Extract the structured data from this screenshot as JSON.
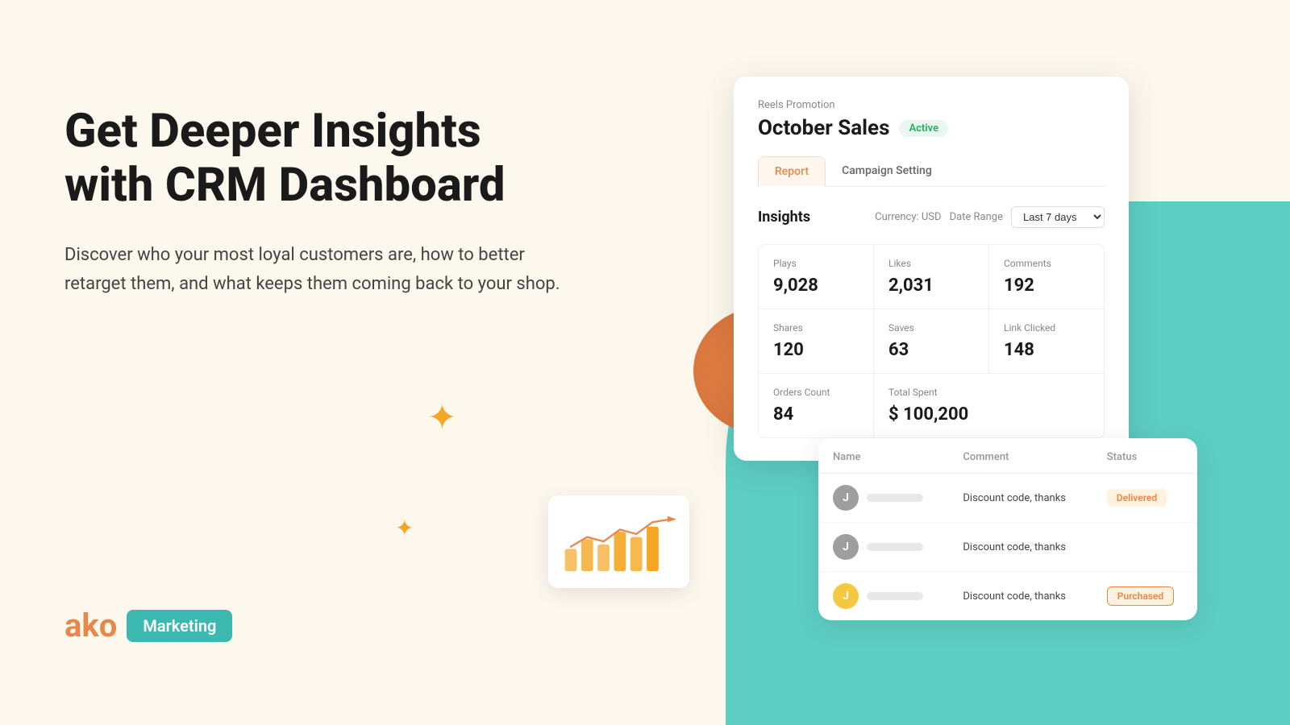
{
  "page": {
    "background_color": "#fdf8ee"
  },
  "hero": {
    "heading": "Get Deeper Insights with CRM Dashboard",
    "subtext": "Discover who your most loyal customers are, how to better retarget them, and what keeps them coming back to your shop."
  },
  "logo": {
    "text": "ako",
    "badge": "Marketing"
  },
  "dashboard": {
    "subtitle": "Reels Promotion",
    "title": "October Sales",
    "active_badge": "Active",
    "tabs": [
      {
        "label": "Report",
        "active": true
      },
      {
        "label": "Campaign Setting",
        "active": false
      }
    ],
    "insights_title": "Insights",
    "currency_label": "Currency: USD",
    "date_range_label": "Date Range",
    "date_range_value": "Last 7 days",
    "metrics": [
      {
        "label": "Plays",
        "value": "9,028"
      },
      {
        "label": "Likes",
        "value": "2,031"
      },
      {
        "label": "Comments",
        "value": "192"
      },
      {
        "label": "Shares",
        "value": "120"
      },
      {
        "label": "Saves",
        "value": "63"
      },
      {
        "label": "Link Clicked",
        "value": "148"
      },
      {
        "label": "Orders Count",
        "value": "84"
      },
      {
        "label": "Total Spent",
        "value": "$ 100,200"
      }
    ]
  },
  "comments_table": {
    "columns": [
      "Name",
      "Comment",
      "Status"
    ],
    "rows": [
      {
        "avatar_letter": "J",
        "avatar_color": "gray",
        "comment": "Discount code, thanks",
        "status": "Delivered",
        "status_type": "delivered"
      },
      {
        "avatar_letter": "J",
        "avatar_color": "gray",
        "comment": "Discount code, thanks",
        "status": "",
        "status_type": "none"
      },
      {
        "avatar_letter": "J",
        "avatar_color": "yellow",
        "comment": "Discount code, thanks",
        "status": "Purchased",
        "status_type": "purchased"
      }
    ]
  },
  "chart": {
    "bars": [
      40,
      55,
      45,
      65,
      60,
      75
    ],
    "bar_color": "#f5a623",
    "line_color": "#e8874a"
  }
}
